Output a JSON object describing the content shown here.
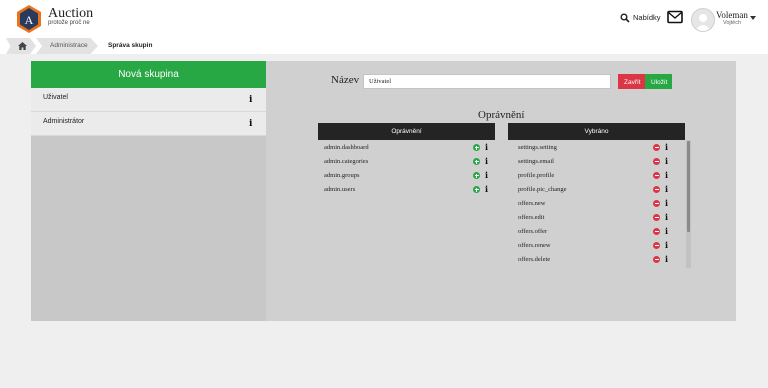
{
  "header": {
    "brand": "Auction",
    "tagline": "protože proč ne",
    "logo_letter": "A",
    "offers_link": "Nabídky",
    "user": {
      "name": "Voleman",
      "subtitle": "Vojtěch"
    }
  },
  "breadcrumb": {
    "items": [
      "Administrace"
    ],
    "current": "Správa skupin"
  },
  "sidebar": {
    "new_group_label": "Nová skupina",
    "groups": [
      {
        "label": "Uživatel"
      },
      {
        "label": "Administrátor"
      }
    ]
  },
  "form": {
    "name_label": "Název",
    "name_value": "Uživatel",
    "close_label": "Zavřít",
    "save_label": "Uložit"
  },
  "permissions": {
    "title": "Oprávnění",
    "available_header": "Oprávnění",
    "selected_header": "Vybráno",
    "available": [
      "admin.dashboard",
      "admin.categories",
      "admin.groups",
      "admin.users"
    ],
    "selected": [
      "settings.setting",
      "settings.email",
      "profile.profile",
      "profile.pic_change",
      "offers.new",
      "offers.edit",
      "offers.offer",
      "offers.renew",
      "offers.delete"
    ]
  },
  "colors": {
    "accent_green": "#28a745",
    "accent_red": "#dc3545",
    "header_dark": "#242424",
    "logo_orange": "#e8731c",
    "logo_navy": "#2a3a5c"
  },
  "icons": {
    "home": "home-icon",
    "search": "search-icon",
    "mail": "envelope-icon",
    "info": "info-icon",
    "add": "plus-circle-icon",
    "remove": "minus-circle-icon",
    "caret": "caret-down-icon"
  }
}
